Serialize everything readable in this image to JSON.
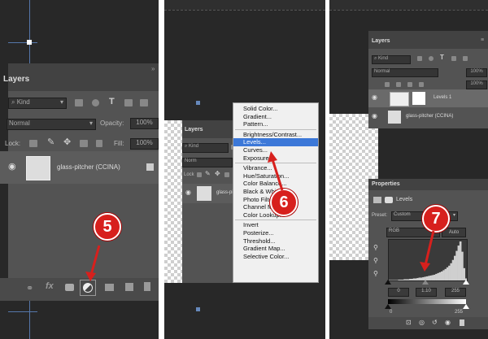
{
  "left": {
    "panel_title": "Layers",
    "kind_label": "Kind",
    "blend_mode": "Normal",
    "opacity_label": "Opacity:",
    "opacity_value": "100%",
    "lock_label": "Lock:",
    "fill_label": "Fill:",
    "fill_value": "100%",
    "layer_name": "glass-pitcher (CCINA)",
    "fx_label": "fx",
    "step": "5"
  },
  "middle": {
    "panel_title": "Layers",
    "kind_label": "Kind",
    "blend_mode": "Norm",
    "lock_label": "Lock",
    "layer_name": "glass-pit",
    "step": "6",
    "menu": {
      "group1": [
        "Solid Color...",
        "Gradient...",
        "Pattern..."
      ],
      "group2": [
        "Brightness/Contrast...",
        "Levels...",
        "Curves...",
        "Exposure..."
      ],
      "group3": [
        "Vibrance...",
        "Hue/Saturation...",
        "Color Balance...",
        "Black & White...",
        "Photo Filter...",
        "Channel Mixer...",
        "Color Lookup..."
      ],
      "group4": [
        "Invert",
        "Posterize...",
        "Threshold...",
        "Gradient Map...",
        "Selective Color..."
      ],
      "highlighted": "Levels..."
    }
  },
  "right": {
    "layers_title": "Layers",
    "kind_label": "Kind",
    "blend_mode": "Normal",
    "opacity_value": "100%",
    "fill_value": "100%",
    "adj_layer_name": "Levels 1",
    "layer_name": "glass-pitcher (CCINA)",
    "properties_title": "Properties",
    "levels_label": "Levels",
    "preset_label": "Preset:",
    "preset_value": "Custom",
    "channel_value": "RGB",
    "auto_label": "Auto",
    "input_black": "0",
    "input_gamma": "1.10",
    "input_white": "255",
    "output_black": "0",
    "output_white": "255",
    "step": "7",
    "histogram": [
      1,
      1,
      1,
      1,
      1,
      2,
      2,
      2,
      3,
      3,
      3,
      4,
      4,
      5,
      5,
      6,
      7,
      7,
      8,
      9,
      10,
      11,
      12,
      13,
      14,
      16,
      18,
      20,
      22,
      25,
      28,
      32,
      36,
      42,
      50,
      60,
      72,
      85,
      95,
      70,
      30,
      5
    ]
  },
  "colors": {
    "badge": "#d7201d",
    "arrow": "#d7201d",
    "menu_highlight": "#3c78d8",
    "panel_bg": "#535353"
  }
}
